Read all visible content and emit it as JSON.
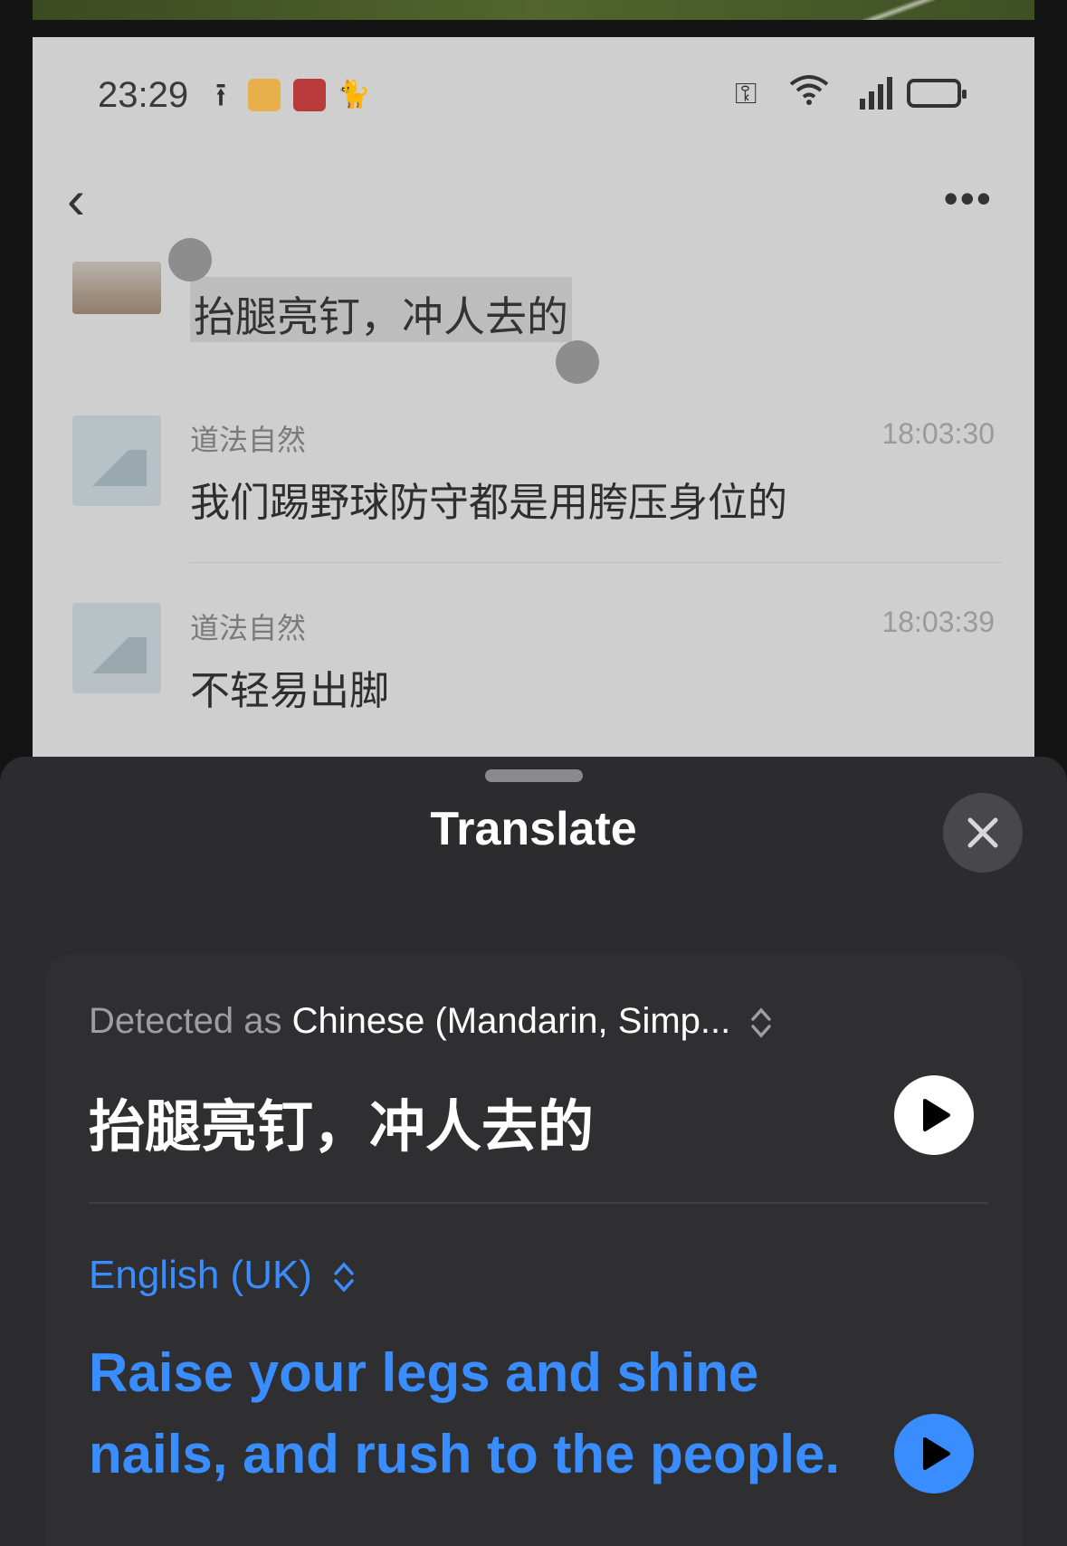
{
  "status_bar": {
    "time": "23:29"
  },
  "chat": {
    "selected_message": "抬腿亮钉，冲人去的",
    "messages": [
      {
        "sender": "道法自然",
        "time": "18:03:30",
        "text": "我们踢野球防守都是用胯压身位的"
      },
      {
        "sender": "道法自然",
        "time": "18:03:39",
        "text": "不轻易出脚"
      }
    ]
  },
  "sheet": {
    "title": "Translate",
    "source": {
      "detected_prefix": "Detected as",
      "language": "Chinese (Mandarin, Simp...",
      "text": "抬腿亮钉，冲人去的"
    },
    "target": {
      "language": "English (UK)",
      "text": "Raise your legs and shine nails, and rush to the people."
    }
  },
  "colors": {
    "accent": "#3a8dff",
    "sheet_bg": "#2c2c2e",
    "panel_bg": "#2f2f31"
  },
  "icons": [
    "upload-icon",
    "key-icon",
    "wifi-icon",
    "signal-icon",
    "battery-icon",
    "back-icon",
    "more-icon",
    "close-icon",
    "chevron-updown-icon",
    "play-icon"
  ]
}
